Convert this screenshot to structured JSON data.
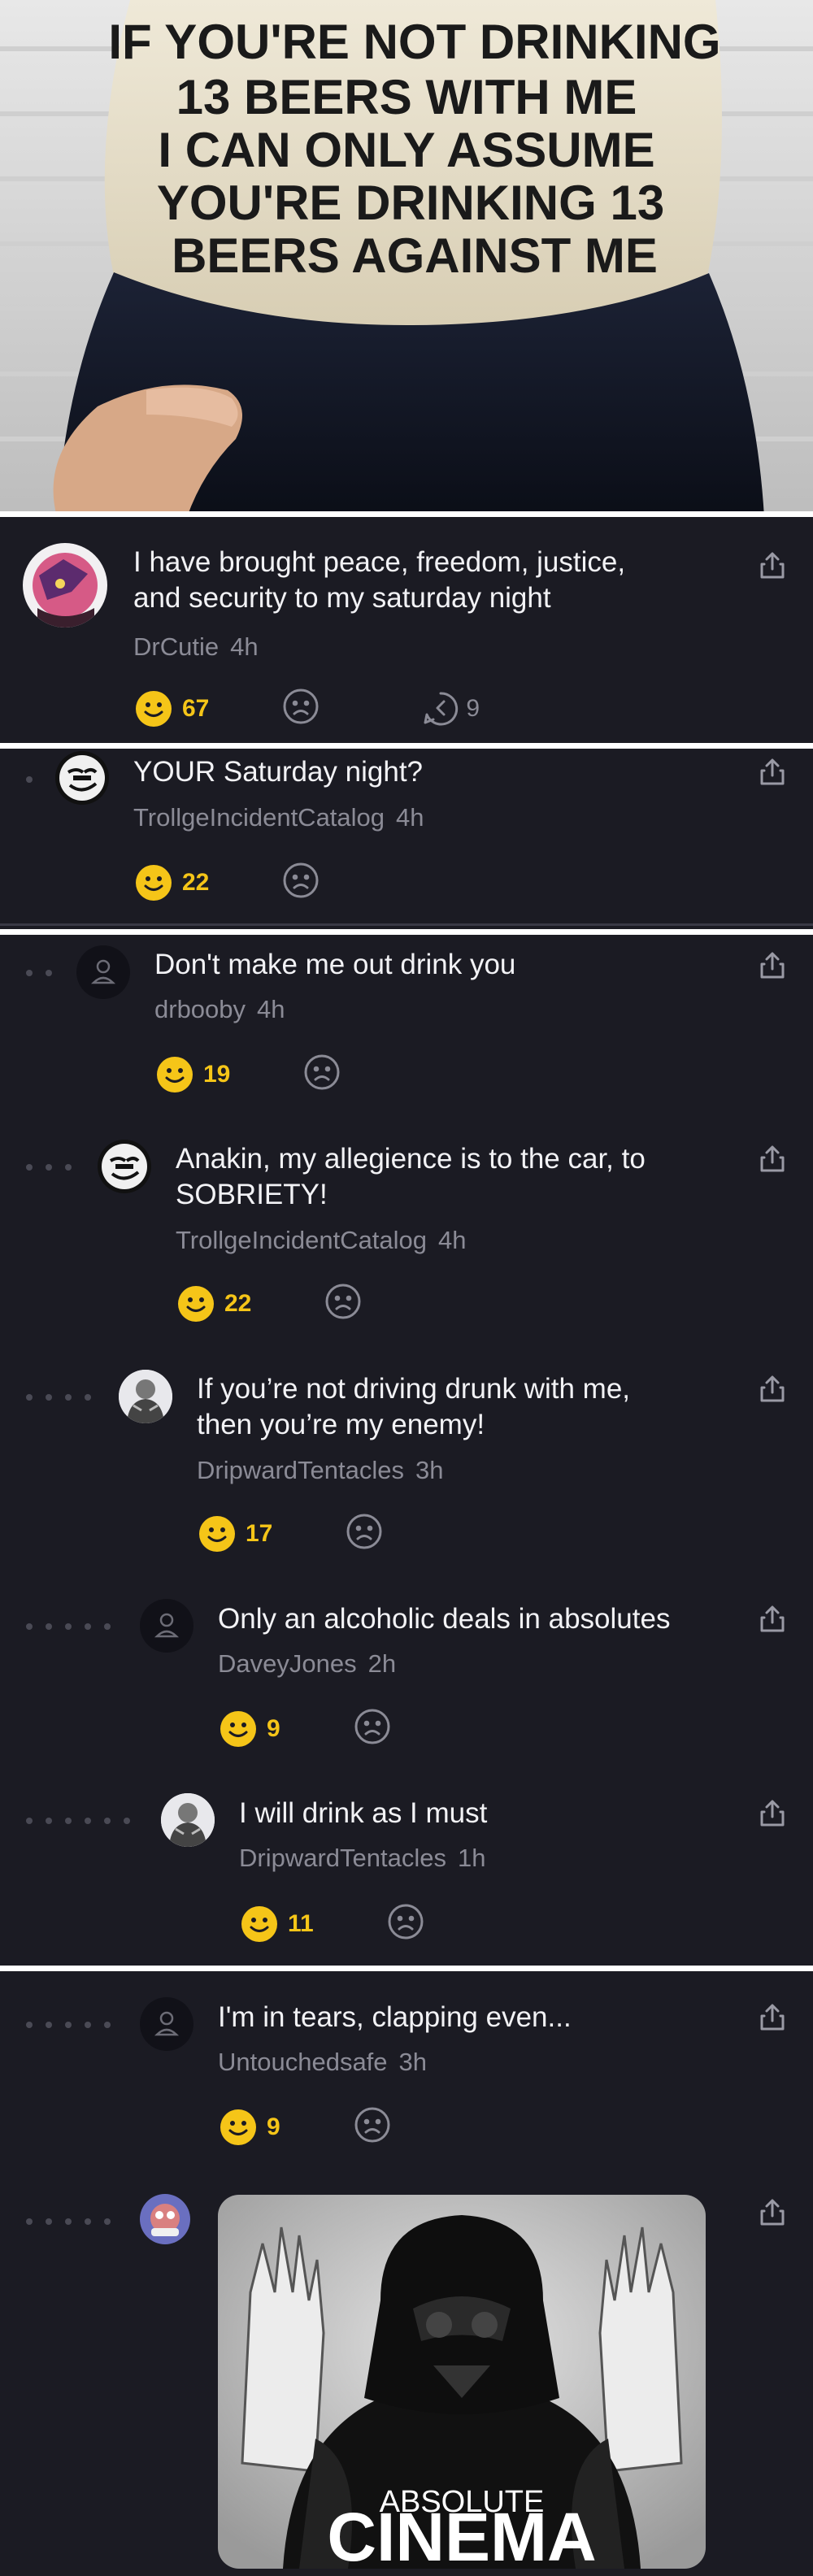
{
  "photo": {
    "hat_lines": [
      "IF YOU'RE NOT DRINKING",
      "13 BEERS WITH ME",
      "I CAN ONLY ASSUME",
      "YOU'RE DRINKING 13",
      "BEERS AGAINST ME"
    ]
  },
  "post": {
    "text_line1": "I have brought peace, freedom, justice,",
    "text_line2": "and security to my saturday night",
    "author": "DrCutie",
    "time": "4h",
    "likes": "67",
    "replies": "9"
  },
  "comments": [
    {
      "text": "YOUR Saturday night?",
      "author": "TrollgeIncidentCatalog",
      "time": "4h",
      "likes": "22"
    },
    {
      "text": "Don't make me out drink you",
      "author": "drbooby",
      "time": "4h",
      "likes": "19"
    },
    {
      "text_line1": "Anakin, my allegience is to the car, to",
      "text_line2": "SOBRIETY!",
      "author": "TrollgeIncidentCatalog",
      "time": "4h",
      "likes": "22"
    },
    {
      "text_line1": "If you’re not driving drunk with me,",
      "text_line2": "then you’re my enemy!",
      "author": "DripwardTentacles",
      "time": "3h",
      "likes": "17"
    },
    {
      "text": "Only an alcoholic deals in absolutes",
      "author": "DaveyJones",
      "time": "2h",
      "likes": "9"
    },
    {
      "text": "I will drink as I must",
      "author": "DripwardTentacles",
      "time": "1h",
      "likes": "11"
    },
    {
      "text": "I'm in tears, clapping even...",
      "author": "Untouchedsafe",
      "time": "3h",
      "likes": "9"
    }
  ],
  "meme": {
    "line1": "ABSOLUTE",
    "line2": "CINEMA"
  },
  "colors": {
    "background": "#1b1b23",
    "accent": "#f5c518",
    "muted": "#8b8b96",
    "separator": "#ffffff"
  },
  "icons": [
    "smile-icon",
    "frown-icon",
    "reply-icon",
    "share-icon",
    "default-avatar-icon"
  ]
}
